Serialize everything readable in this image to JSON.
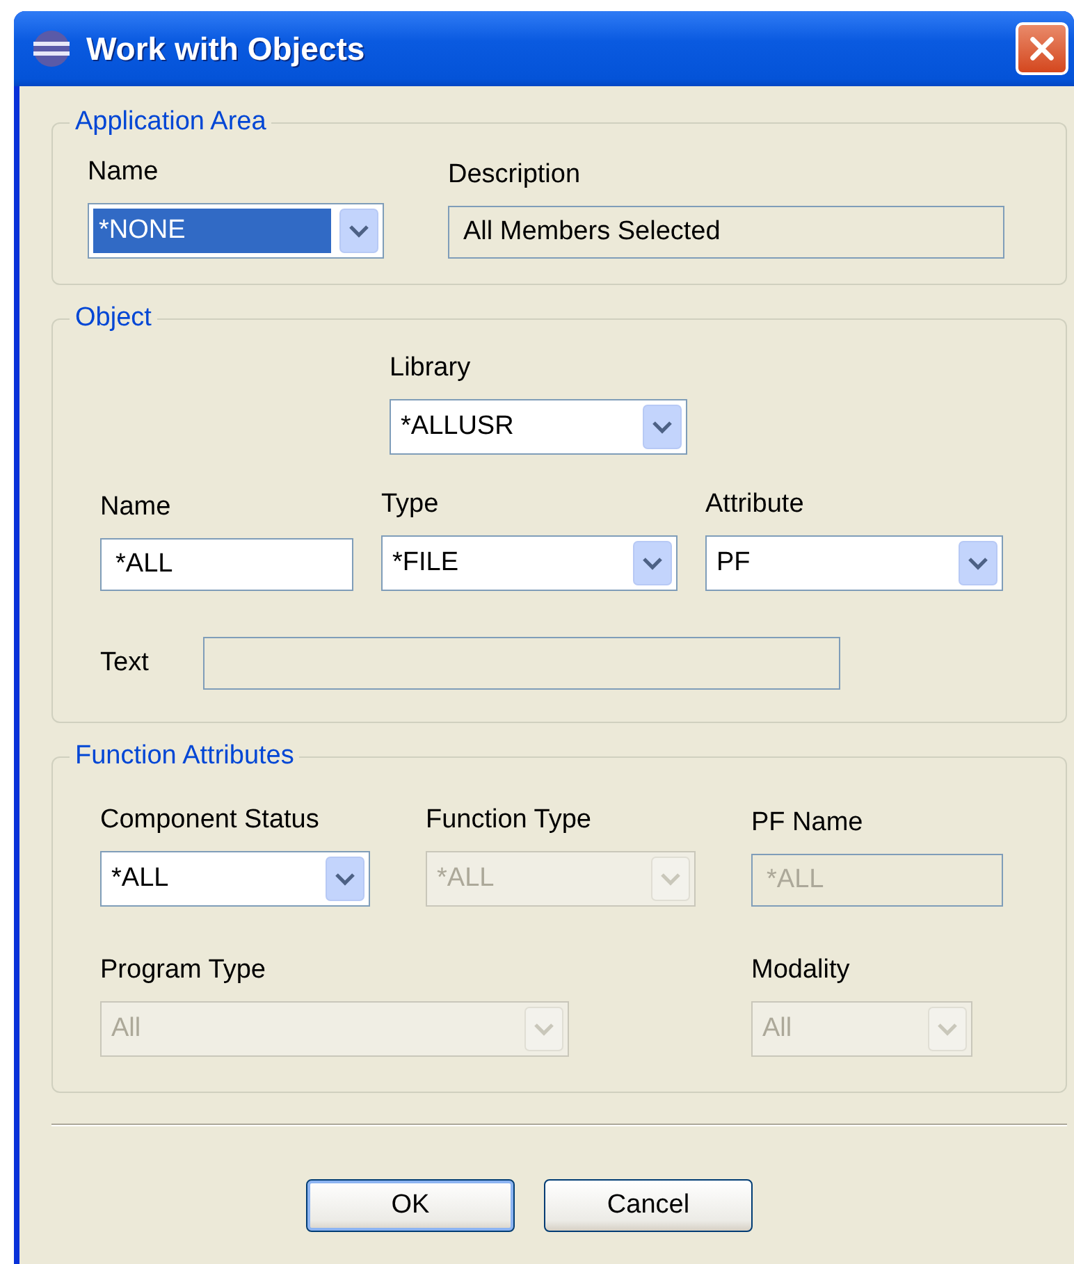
{
  "window": {
    "title": "Work with Objects"
  },
  "groups": [
    {
      "title": "Application Area",
      "rows": [
        [
          {
            "kind": "combo",
            "label": "Name",
            "value": "*NONE",
            "highlighted": true,
            "disabled": false
          },
          {
            "kind": "text",
            "label": "Description",
            "value": "All Members Selected",
            "editable": false,
            "disabled": false
          }
        ]
      ]
    },
    {
      "title": "Object",
      "rows": [
        [
          "",
          {
            "kind": "combo",
            "label": "Library",
            "value": "*ALLUSR",
            "highlighted": false,
            "disabled": false
          }
        ],
        [
          {
            "kind": "text",
            "label": "Name",
            "value": "*ALL",
            "editable": true,
            "disabled": false
          },
          {
            "kind": "combo",
            "label": "Type",
            "value": "*FILE",
            "highlighted": false,
            "disabled": false
          },
          {
            "kind": "combo",
            "label": "Attribute",
            "value": "PF",
            "highlighted": false,
            "disabled": false
          }
        ],
        [
          {
            "kind": "inline_text",
            "label": "Text",
            "editable": false
          }
        ]
      ]
    },
    {
      "title": "Function Attributes",
      "rows": [
        [
          {
            "kind": "combo",
            "label": "Component Status",
            "value": "*ALL",
            "highlighted": false,
            "disabled": false
          },
          {
            "kind": "combo",
            "label": "Function Type",
            "value": "*ALL",
            "highlighted": false,
            "disabled": true
          },
          {
            "kind": "text",
            "label": "PF Name",
            "value": "*ALL",
            "editable": false,
            "disabled": true
          }
        ],
        [
          {
            "kind": "combo",
            "label": "Program Type",
            "value": "All",
            "highlighted": false,
            "disabled": true
          },
          "",
          {
            "kind": "combo",
            "label": "Modality",
            "value": "All",
            "highlighted": false,
            "disabled": true
          }
        ]
      ]
    }
  ],
  "buttons": [
    {
      "label": "OK",
      "default": true
    },
    {
      "label": "Cancel",
      "default": false
    }
  ]
}
